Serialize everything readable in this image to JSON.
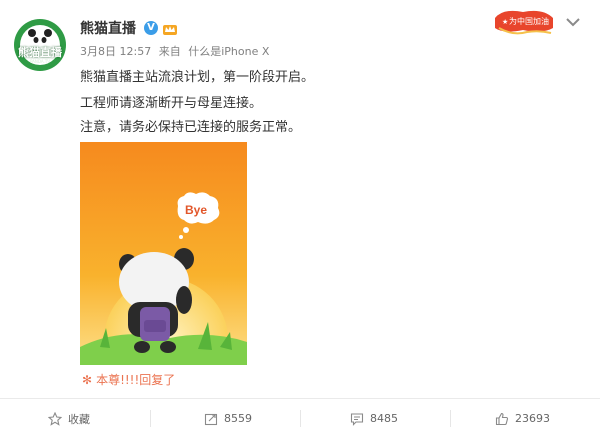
{
  "post": {
    "author": "熊猫直播",
    "avatar_text": "熊猫直播",
    "avatar_sub": "PANDA.TV",
    "verified_mark": "V",
    "date": "3月8日 12:57",
    "via_prefix": "来自",
    "via_device": "什么是iPhone X",
    "lines": [
      "熊猫直播主站流浪计划，第一阶段开启。",
      "工程师请逐渐断开与母星连接。",
      "注意，请务必保持已连接的服务正常。"
    ],
    "image_bubble_text": "Bye",
    "reply_text": "本尊!!!!回复了",
    "banner_text": "为中国加油"
  },
  "actions": {
    "favorite_label": "收藏",
    "share_count": "8559",
    "comment_count": "8485",
    "like_count": "23693"
  },
  "colors": {
    "accent": "#eb7350",
    "verified": "#3b9de8",
    "avatar_green": "#2f9b45",
    "photo_orange": "#f7941d"
  }
}
